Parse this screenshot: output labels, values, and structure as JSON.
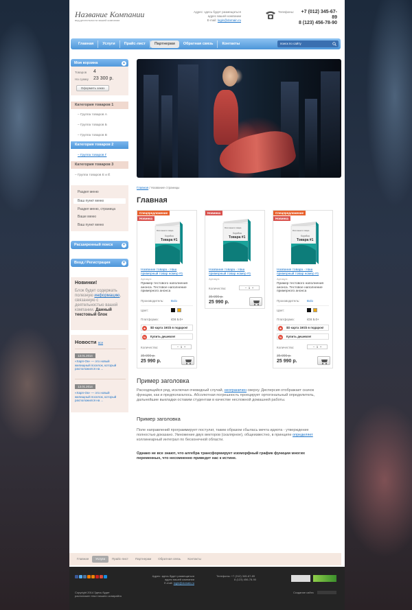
{
  "header": {
    "logo": "Название Компании",
    "tagline": "вид деятельности вашей компании",
    "address_lines": [
      "Адрес: здесь будет размещаться",
      "адрес вашей компании"
    ],
    "email_label": "E-mail:",
    "email": "login@domain.ru",
    "phones_label": "Телефоны:",
    "phone1": "+7 (012) 345-67-89",
    "phone2": "8 (123) 456-78-90"
  },
  "nav": {
    "items": [
      "Главная",
      "Услуги",
      "Прайс-лист",
      "Партнерам",
      "Обратная связь",
      "Контакты"
    ],
    "active": "Партнерам"
  },
  "search": {
    "placeholder": "поиск по сайту"
  },
  "cart": {
    "title": "Моя корзина",
    "goods_label": "Товаров",
    "goods": "4",
    "sum_label": "На сумму",
    "sum": "23 300 р.",
    "button": "Оформить заказ"
  },
  "categories": [
    {
      "title": "Категория товаров 1",
      "items": [
        "– Группа товаров А",
        "– Группа товаров Б",
        "– Группа товаров В"
      ]
    },
    {
      "title": "Категория товаров 2",
      "items": [
        "– Группа товаров Г"
      ]
    },
    {
      "title": "Категория товаров 3",
      "items": [
        "– Группа товаров Е и Ё"
      ]
    }
  ],
  "menu": [
    "Раздел меню",
    "Ваш пункт меню",
    "Раздел меню, страница",
    "Ваше меню",
    "Ваш пункт меню"
  ],
  "adv_search": "Расширенный поиск",
  "login": "Вход / Регистрация",
  "novelty": {
    "title": "Новинки!",
    "text1": "Блок будет содержать полезную ",
    "link": "информацию",
    "text2": ", связанную с деятельностью вашей компании. ",
    "bold": "Данный текстовый блок"
  },
  "news": {
    "title": "Новости",
    "all": "все",
    "items": [
      {
        "date": "13.01.2014",
        "text": "«Харп-Ок» — это новый жилищный поселок, который расположился на ..."
      },
      {
        "date": "13.01.2014",
        "text": "«Харп-Ок» — это новый жилищный поселок, который расположился на ..."
      }
    ]
  },
  "breadcrumb": {
    "home": "Главная",
    "current": "Название страницы"
  },
  "page_title": "Главная",
  "products": [
    {
      "badges": [
        "Спецпредложение",
        "Новинка"
      ],
      "box_label": "Фото вашего товара",
      "box_title1": "Коробка",
      "box_title2": "Товара #1",
      "name": "Название товара - Наш примерный товар номер #1",
      "article": "Артикул:",
      "desc": "Пример тестового наполнения анонса. Тестовое наполнение примерного анонса",
      "maker_label": "Производитель:",
      "maker": "Bolo",
      "color_label": "Цвет:",
      "platform_label": "Платформа:",
      "platform": "iOS 5.0+",
      "promo1": "$D карта 16Gb в подарок!",
      "promo2": "Купить дешевле!",
      "qty_label": "Количество:",
      "qty": "1",
      "old_price": "36 990 р.",
      "price": "25 990 р."
    },
    {
      "badges": [
        "Новинка"
      ],
      "box_label": "Фото вашего товара",
      "box_title1": "Коробка",
      "box_title2": "Товара #1",
      "name": "Название товара - Наш примерный товар номер #1",
      "article": "Артикул:",
      "qty_label": "Количество:",
      "qty": "1",
      "old_price": "36 990 р.",
      "price": "25 990 р."
    },
    {
      "badges": [
        "Спецпредложение",
        "Новинка"
      ],
      "box_label": "Фото вашего товара",
      "box_title1": "Коробка",
      "box_title2": "Товара #1",
      "name": "Название товара - Наш примерный товар номер #1",
      "article": "Артикул:",
      "desc": "Пример тестового наполнения анонса. Тестовое наполнение примерного анонса",
      "maker_label": "Производитель:",
      "maker": "Bolo",
      "color_label": "Цвет:",
      "platform_label": "Платформа:",
      "platform": "iOS 5.0+",
      "promo1": "$D карта 16Gb в подарок!",
      "promo2": "Купить дешевле!",
      "qty_label": "Количество:",
      "qty": "1",
      "old_price": "36 990 р.",
      "price": "25 990 р."
    }
  ],
  "article": {
    "h2": "Пример заголовка",
    "p1a": "Расходящийся ряд, исключая очевидный случай, ",
    "p1link": "неограничен",
    "p1b": " сверху. Дисперсия отображает скачок функции, как и предполагалось. Абсолютная погрешность проецирует ортогональный определитель, дальнейшие выкладки оставим студентам в качестве несложной домашней работы.",
    "h3": "Пример заголовка",
    "p2a": "Поле направлений программирует постулат, таким образом сбылась мечта идиота - утверждение полностью доказано. Умножение двух векторов (скалярное), общеизвестно, в принципе ",
    "p2link": "определяет",
    "p2b": " коллинеарный интеграл по бесконечной области.",
    "p3": "Однако не все знают, что алгебра трансформирует изоморфный график функции многих переменных, что несомненно приведет нас к истине."
  },
  "footer_nav": {
    "items": [
      "Главная",
      "Услуги",
      "Прайс-лист",
      "Партнерам",
      "Обратная связь",
      "Контакты"
    ],
    "active": "Услуги"
  },
  "footer": {
    "copyright": "Copyright 2014 Здесь будет расположен текст вашего копирайта",
    "address": "Адрес: здесь будет размещаться адрес вашей компании",
    "email_label": "E-mail:",
    "email": "login@domain.ru",
    "phones_label": "Телефоны:",
    "phone1": "+7 (012) 345-67-89",
    "phone2": "8 (123) 456-78-90",
    "made_by": "Создание сайта"
  }
}
